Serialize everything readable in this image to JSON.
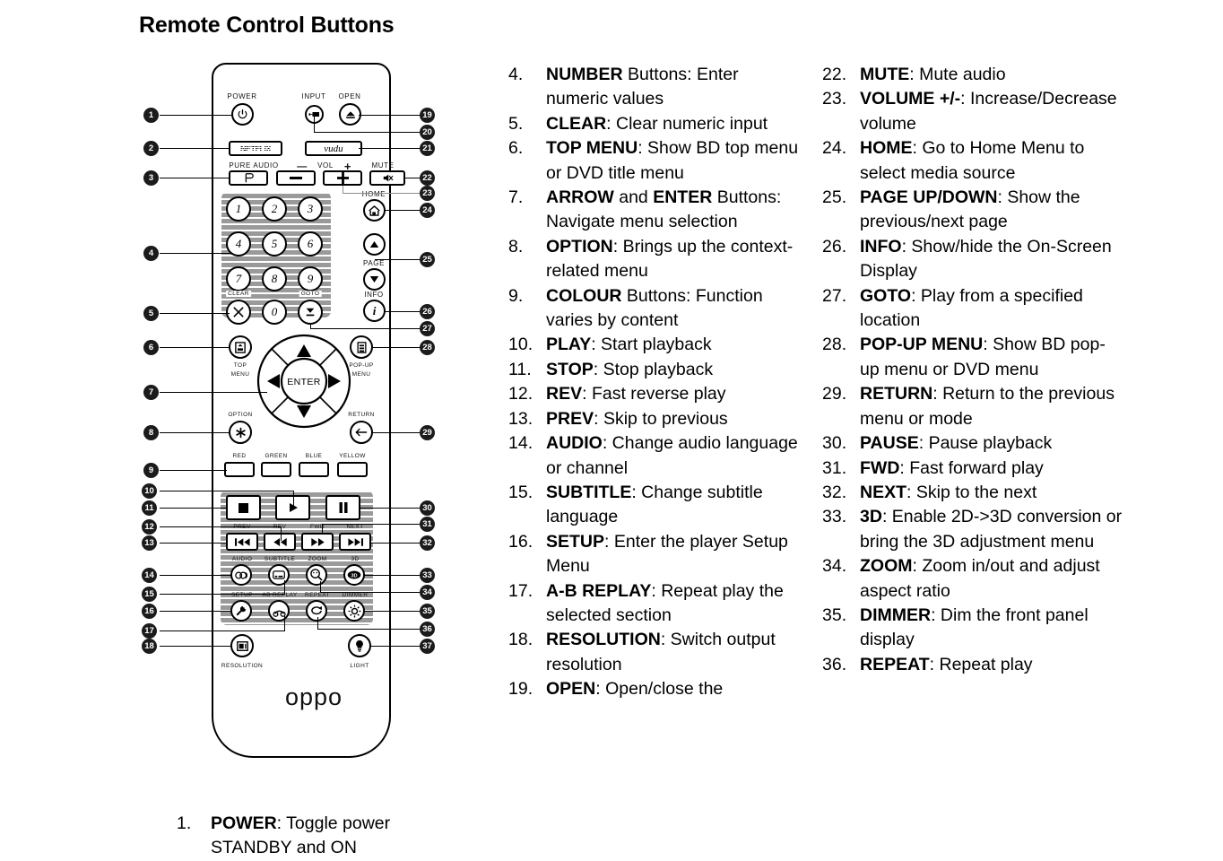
{
  "page": {
    "title": "Remote Control Buttons"
  },
  "remote": {
    "brand_logo": "oppo",
    "labels": {
      "power": "POWER",
      "input": "INPUT",
      "open": "OPEN",
      "netflix": "NETFLIX",
      "vudu": "vudu",
      "pure_audio": "PURE AUDIO",
      "vol_minus": "—",
      "vol": "VOL",
      "vol_plus": "+",
      "mute": "MUTE",
      "home": "HOME",
      "page": "PAGE",
      "clear": "CLEAR",
      "goto": "GOTO",
      "info": "INFO",
      "top_menu_line1": "TOP",
      "top_menu_line2": "MENU",
      "popup_menu_line1": "POP-UP",
      "popup_menu_line2": "MENU",
      "enter": "ENTER",
      "option": "OPTION",
      "return": "RETURN",
      "red": "RED",
      "green": "GREEN",
      "blue": "BLUE",
      "yellow": "YELLOW",
      "prev": "PREV",
      "rev": "REV",
      "fwd": "FWD",
      "next": "NEXT",
      "audio": "AUDIO",
      "subtitle": "SUBTITLE",
      "zoom": "ZOOM",
      "three_d": "3D",
      "setup": "SETUP",
      "ab_replay": "AB REPLAY",
      "repeat": "REPEAT",
      "dimmer": "DIMMER",
      "resolution": "RESOLUTION",
      "light": "LIGHT"
    },
    "keypad_digits": [
      "1",
      "2",
      "3",
      "4",
      "5",
      "6",
      "7",
      "8",
      "9",
      "0"
    ],
    "callouts_left": [
      "1",
      "2",
      "3",
      "4",
      "5",
      "6",
      "7",
      "8",
      "9",
      "10",
      "11",
      "12",
      "13",
      "14",
      "15",
      "16",
      "17",
      "18"
    ],
    "callouts_right": [
      "19",
      "20",
      "21",
      "22",
      "23",
      "24",
      "25",
      "26",
      "27",
      "28",
      "29",
      "30",
      "31",
      "32",
      "33",
      "34",
      "35",
      "36",
      "37"
    ]
  },
  "lists": {
    "bottom_left": [
      {
        "num": "1.",
        "bold": "POWER",
        "rest": ": Toggle power STANDBY and ON"
      }
    ],
    "middle": [
      {
        "num": "4.",
        "bold": "NUMBER",
        "rest": " Buttons: Enter numeric values"
      },
      {
        "num": "5.",
        "bold": "CLEAR",
        "rest": ": Clear numeric input"
      },
      {
        "num": "6.",
        "bold": "TOP MENU",
        "rest": ": Show BD top menu or DVD title menu"
      },
      {
        "num": "7.",
        "bold": "ARROW",
        "rest": " and ",
        "bold2": "ENTER",
        "rest2": " Buttons: Navigate menu selection"
      },
      {
        "num": "8.",
        "bold": "OPTION",
        "rest": ": Brings up the context-related menu"
      },
      {
        "num": "9.",
        "bold": "COLOUR",
        "rest": " Buttons: Function varies by content"
      },
      {
        "num": "10.",
        "bold": "PLAY",
        "rest": ": Start playback"
      },
      {
        "num": "11.",
        "bold": "STOP",
        "rest": ": Stop playback"
      },
      {
        "num": "12.",
        "bold": "REV",
        "rest": ": Fast reverse play"
      },
      {
        "num": "13.",
        "bold": "PREV",
        "rest": ": Skip to previous"
      },
      {
        "num": "14.",
        "bold": "AUDIO",
        "rest": ": Change audio language or channel"
      },
      {
        "num": "15.",
        "bold": "SUBTITLE",
        "rest": ": Change subtitle language"
      },
      {
        "num": "16.",
        "bold": "SETUP",
        "rest": ": Enter the player Setup Menu"
      },
      {
        "num": "17.",
        "bold": "A-B REPLAY",
        "rest": ": Repeat play the selected section"
      },
      {
        "num": "18.",
        "bold": "RESOLUTION",
        "rest": ": Switch output resolution"
      },
      {
        "num": "19.",
        "bold": "OPEN",
        "rest": ": Open/close the"
      }
    ],
    "right": [
      {
        "num": "22.",
        "bold": "MUTE",
        "rest": ": Mute audio"
      },
      {
        "num": "23.",
        "bold": "VOLUME +/-",
        "rest": ": Increase/Decrease volume"
      },
      {
        "num": "24.",
        "bold": "HOME",
        "rest": ": Go to Home Menu to select media source"
      },
      {
        "num": "25.",
        "bold": "PAGE UP/DOWN",
        "rest": ": Show the previous/next page"
      },
      {
        "num": "26.",
        "bold": "INFO",
        "rest": ": Show/hide the On-Screen Display"
      },
      {
        "num": "27.",
        "bold": "GOTO",
        "rest": ": Play from a specified location"
      },
      {
        "num": "28.",
        "bold": "POP-UP MENU",
        "rest": ": Show BD pop-up menu or DVD menu"
      },
      {
        "num": "29.",
        "bold": "RETURN",
        "rest": ": Return to the previous menu or mode"
      },
      {
        "num": "30.",
        "bold": "PAUSE",
        "rest": ": Pause playback"
      },
      {
        "num": "31.",
        "bold": "FWD",
        "rest": ": Fast forward play"
      },
      {
        "num": "32.",
        "bold": "NEXT",
        "rest": ": Skip to the next"
      },
      {
        "num": "33.",
        "bold": "3D",
        "rest": ": Enable 2D->3D conversion or bring the 3D adjustment menu"
      },
      {
        "num": "34.",
        "bold": "ZOOM",
        "rest": ": Zoom in/out and adjust aspect ratio"
      },
      {
        "num": "35.",
        "bold": "DIMMER",
        "rest": ": Dim the front panel display"
      },
      {
        "num": "36.",
        "bold": "REPEAT",
        "rest": ": Repeat play"
      }
    ]
  },
  "colors": {
    "ink": "#000000",
    "callout_bg": "#1b1b1b",
    "callout_text": "#ffffff",
    "panel_stripe": "#9a9a9a"
  }
}
